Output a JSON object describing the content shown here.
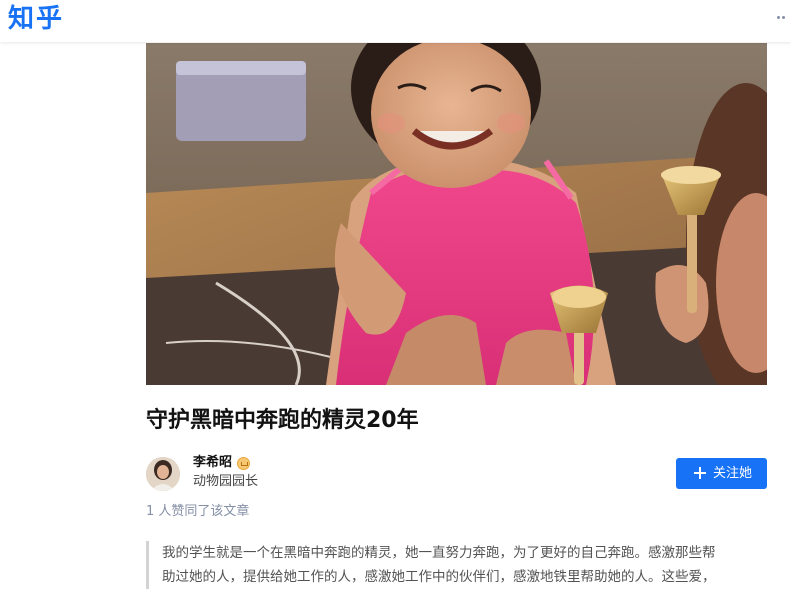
{
  "header": {
    "logo_text": "知乎",
    "more_icon": "more-dots-icon",
    "brand_color": "#1772f6"
  },
  "article": {
    "title": "守护黑暗中奔跑的精灵20年",
    "author": {
      "name": "李希昭",
      "badge_icon": "certified-badge-icon",
      "headline": "动物园园长"
    },
    "follow_button_label": "关注她",
    "upvote_text": "1 人赞同了该文章",
    "quote_lines": [
      "我的学生就是一个在黑暗中奔跑的精灵，她一直努力奔跑，为了更好的自己奔跑。感激那些帮",
      "助过她的人，提供给她工作的人，感激她工作中的伙伴们，感激地铁里帮助她的人。这些爱，"
    ]
  }
}
